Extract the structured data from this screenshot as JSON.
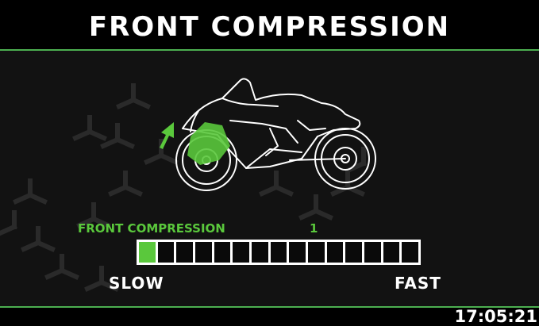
{
  "header": {
    "title": "FRONT COMPRESSION"
  },
  "setting": {
    "label": "FRONT COMPRESSION",
    "value": "1",
    "level": 1,
    "max_level": 15
  },
  "scale": {
    "min_label": "SLOW",
    "max_label": "FAST"
  },
  "status": {
    "time": "17:05:21"
  },
  "colors": {
    "accent": "#5ac83c",
    "divider": "#4caf50",
    "background": "#121212",
    "bar_frame": "#ffffff"
  },
  "icons": {
    "bike": "sport-motorcycle-icon",
    "indicator": "up-arrow-icon",
    "highlight": "front-fork-highlight"
  }
}
